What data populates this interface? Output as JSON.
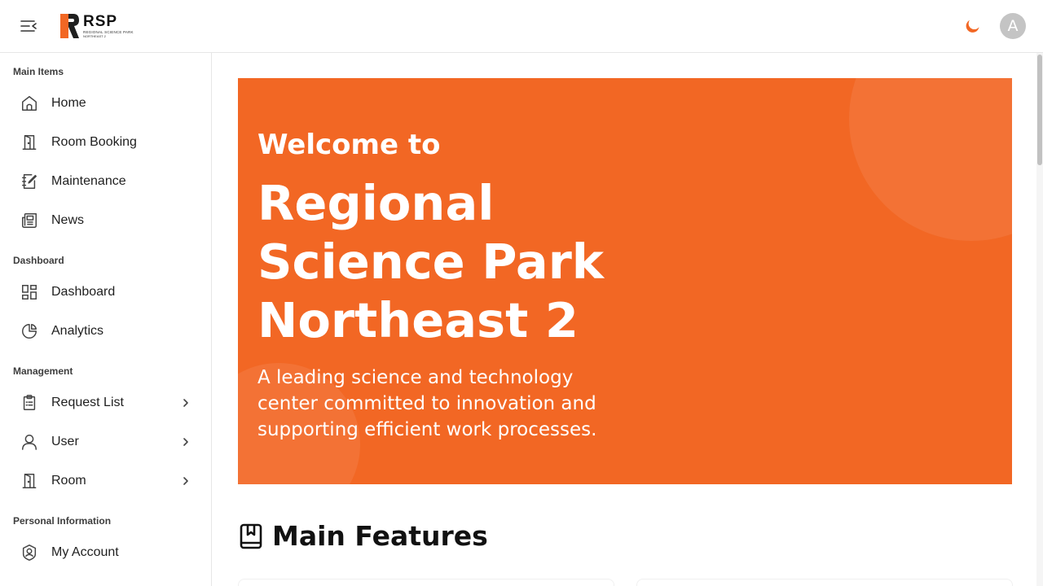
{
  "header": {
    "logo_text": "RSP",
    "logo_sub": "REGIONAL SCIENCE PARK",
    "logo_sub2": "NORTHEAST 2",
    "avatar_initial": "A",
    "accent_color": "#f26724"
  },
  "sidebar": {
    "sections": [
      {
        "title": "Main Items"
      },
      {
        "title": "Dashboard"
      },
      {
        "title": "Management"
      },
      {
        "title": "Personal Information"
      }
    ],
    "items": [
      {
        "label": "Home",
        "icon": "home-icon"
      },
      {
        "label": "Room Booking",
        "icon": "door-icon"
      },
      {
        "label": "Maintenance",
        "icon": "edit-note-icon"
      },
      {
        "label": "News",
        "icon": "newspaper-icon"
      },
      {
        "label": "Dashboard",
        "icon": "grid-icon"
      },
      {
        "label": "Analytics",
        "icon": "pie-chart-icon"
      },
      {
        "label": "Request List",
        "icon": "clipboard-icon"
      },
      {
        "label": "User",
        "icon": "user-icon"
      },
      {
        "label": "Room",
        "icon": "door-icon"
      },
      {
        "label": "My Account",
        "icon": "user-shield-icon"
      }
    ]
  },
  "hero": {
    "welcome": "Welcome to",
    "title": "Regional Science Park Northeast 2",
    "description": "A leading science and technology center committed to innovation and supporting efficient work processes."
  },
  "features": {
    "title": "Main Features",
    "icon": "book-icon"
  }
}
